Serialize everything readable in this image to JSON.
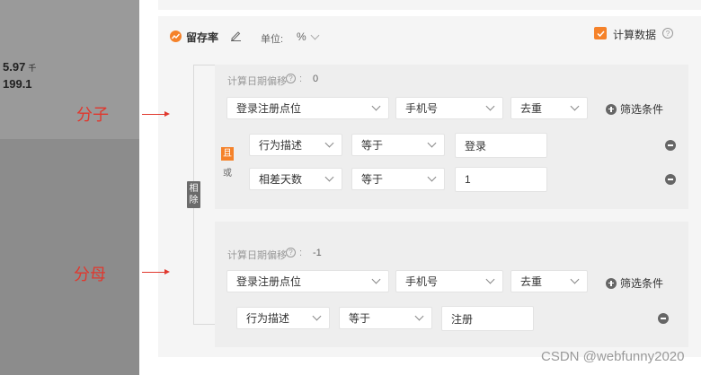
{
  "overlay": {
    "value1": "5.97",
    "unit1": "千",
    "value2": "199.1"
  },
  "metric": {
    "name": "留存率",
    "unit_label": "单位:",
    "unit_value": "%",
    "calc_data_label": "计算数据",
    "calc_data_checked": true
  },
  "operator_label": "相除",
  "numerator": {
    "annotation": "分子",
    "offset_label": "计算日期偏移",
    "offset_value": "0",
    "event_select": "登录注册点位",
    "field_select": "手机号",
    "agg_select": "去重",
    "add_filter": "筛选条件",
    "logic_and": "且",
    "logic_or": "或",
    "filters": [
      {
        "prop": "行为描述",
        "op": "等于",
        "value": "登录"
      },
      {
        "prop": "相差天数",
        "op": "等于",
        "value": "1"
      }
    ]
  },
  "denominator": {
    "annotation": "分母",
    "offset_label": "计算日期偏移",
    "offset_value": "-1",
    "event_select": "登录注册点位",
    "field_select": "手机号",
    "agg_select": "去重",
    "add_filter": "筛选条件",
    "filters": [
      {
        "prop": "行为描述",
        "op": "等于",
        "value": "注册"
      }
    ]
  },
  "watermark": "CSDN @webfunny2020",
  "colors": {
    "accent_orange": "#f5822a",
    "annotation_red": "#e0382e",
    "panel_bg": "#f5f5f5",
    "overlay_gray": "#8c8c8c"
  }
}
